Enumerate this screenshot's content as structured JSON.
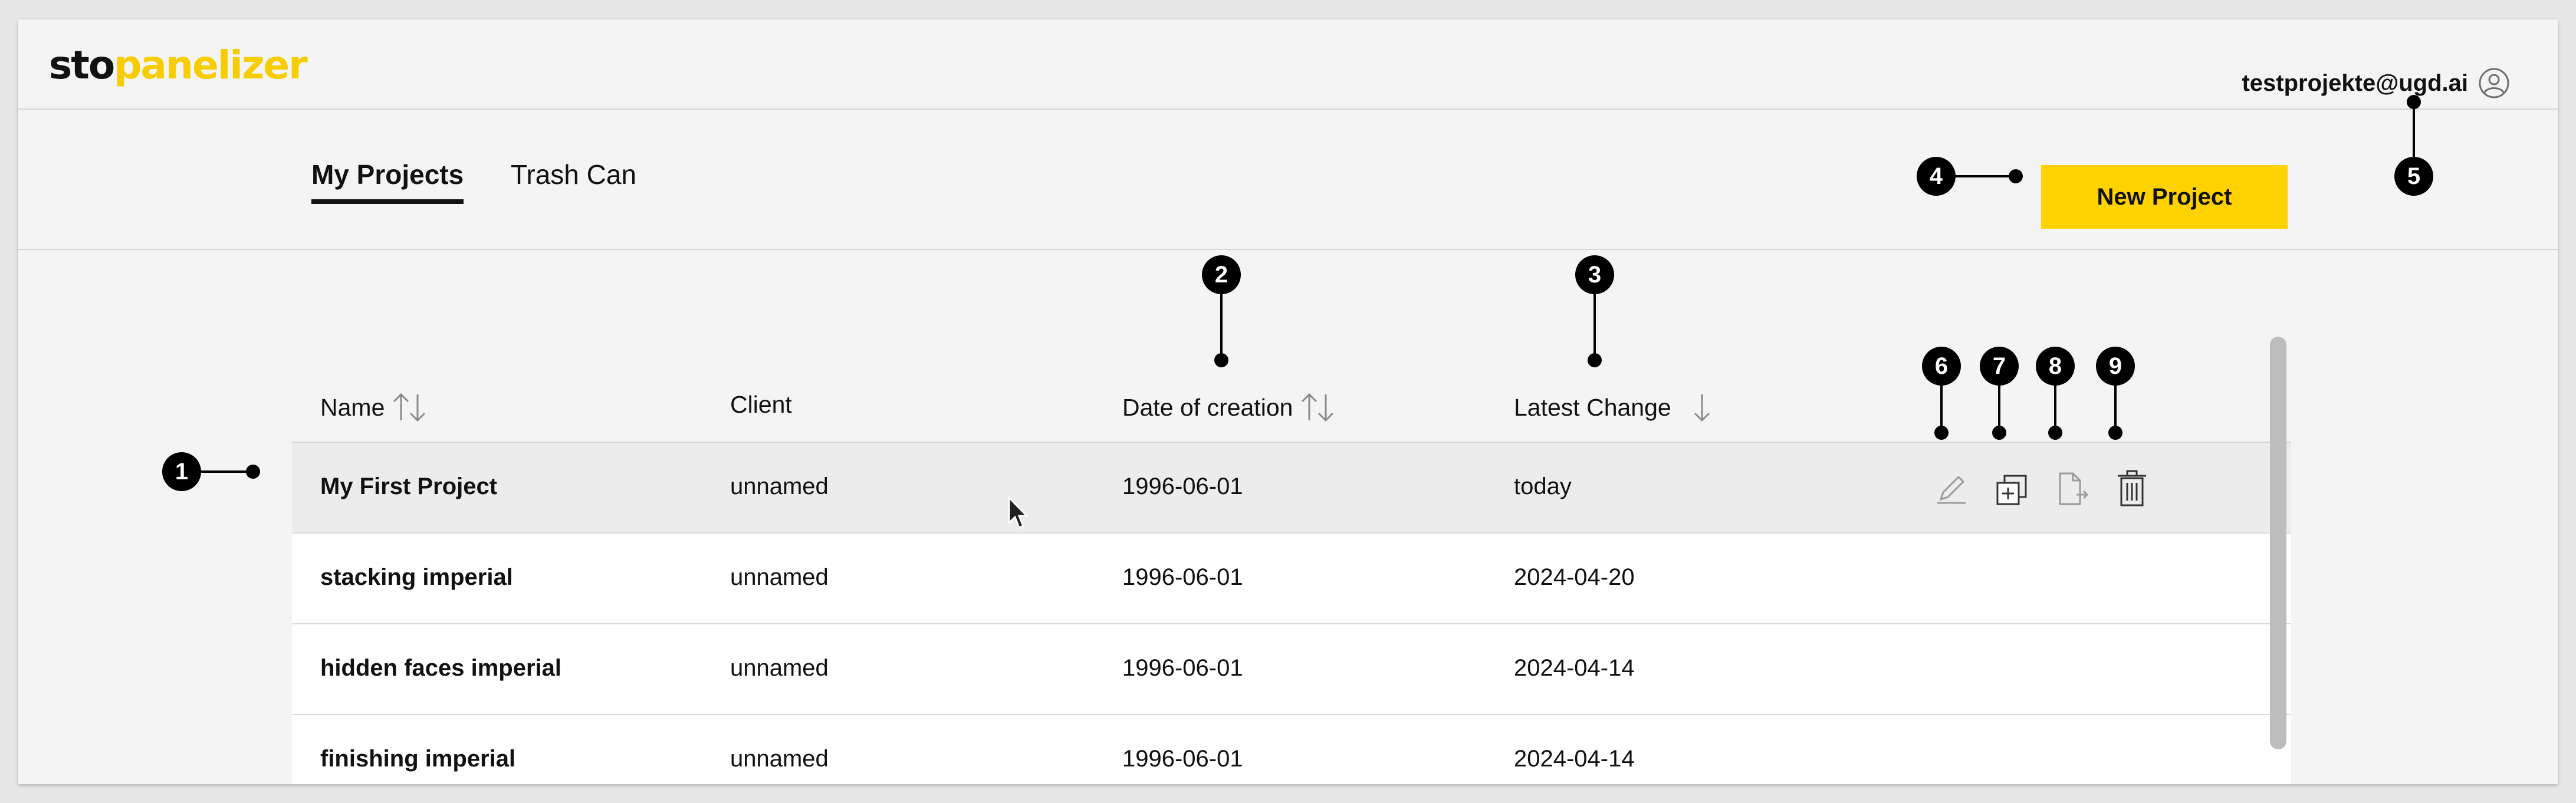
{
  "header": {
    "logo_part1": "sto",
    "logo_part2": "panelizer",
    "user_email": "testprojekte@ugd.ai",
    "user_icon": "user-circle-icon"
  },
  "tabs": [
    {
      "label": "My Projects",
      "active": true
    },
    {
      "label": "Trash Can",
      "active": false
    }
  ],
  "new_project_label": "New Project",
  "table": {
    "columns": [
      {
        "label": "Name",
        "sort": "both"
      },
      {
        "label": "Client",
        "sort": "none"
      },
      {
        "label": "Date of creation",
        "sort": "both"
      },
      {
        "label": "Latest Change",
        "sort": "desc"
      }
    ],
    "rows": [
      {
        "name": "My First Project",
        "client": "unnamed",
        "created": "1996-06-01",
        "changed": "today",
        "hovered": true
      },
      {
        "name": "stacking imperial",
        "client": "unnamed",
        "created": "1996-06-01",
        "changed": "2024-04-20"
      },
      {
        "name": "hidden faces imperial",
        "client": "unnamed",
        "created": "1996-06-01",
        "changed": "2024-04-14"
      },
      {
        "name": "finishing imperial",
        "client": "unnamed",
        "created": "1996-06-01",
        "changed": "2024-04-14"
      }
    ],
    "row_actions": [
      "edit-pencil-icon",
      "duplicate-icon",
      "export-file-icon",
      "trash-icon"
    ]
  },
  "annotations": [
    "1",
    "2",
    "3",
    "4",
    "5",
    "6",
    "7",
    "8",
    "9"
  ],
  "colors": {
    "accent": "#ffd200",
    "logo_yellow": "#f7cd00",
    "background": "#f4f4f5"
  }
}
